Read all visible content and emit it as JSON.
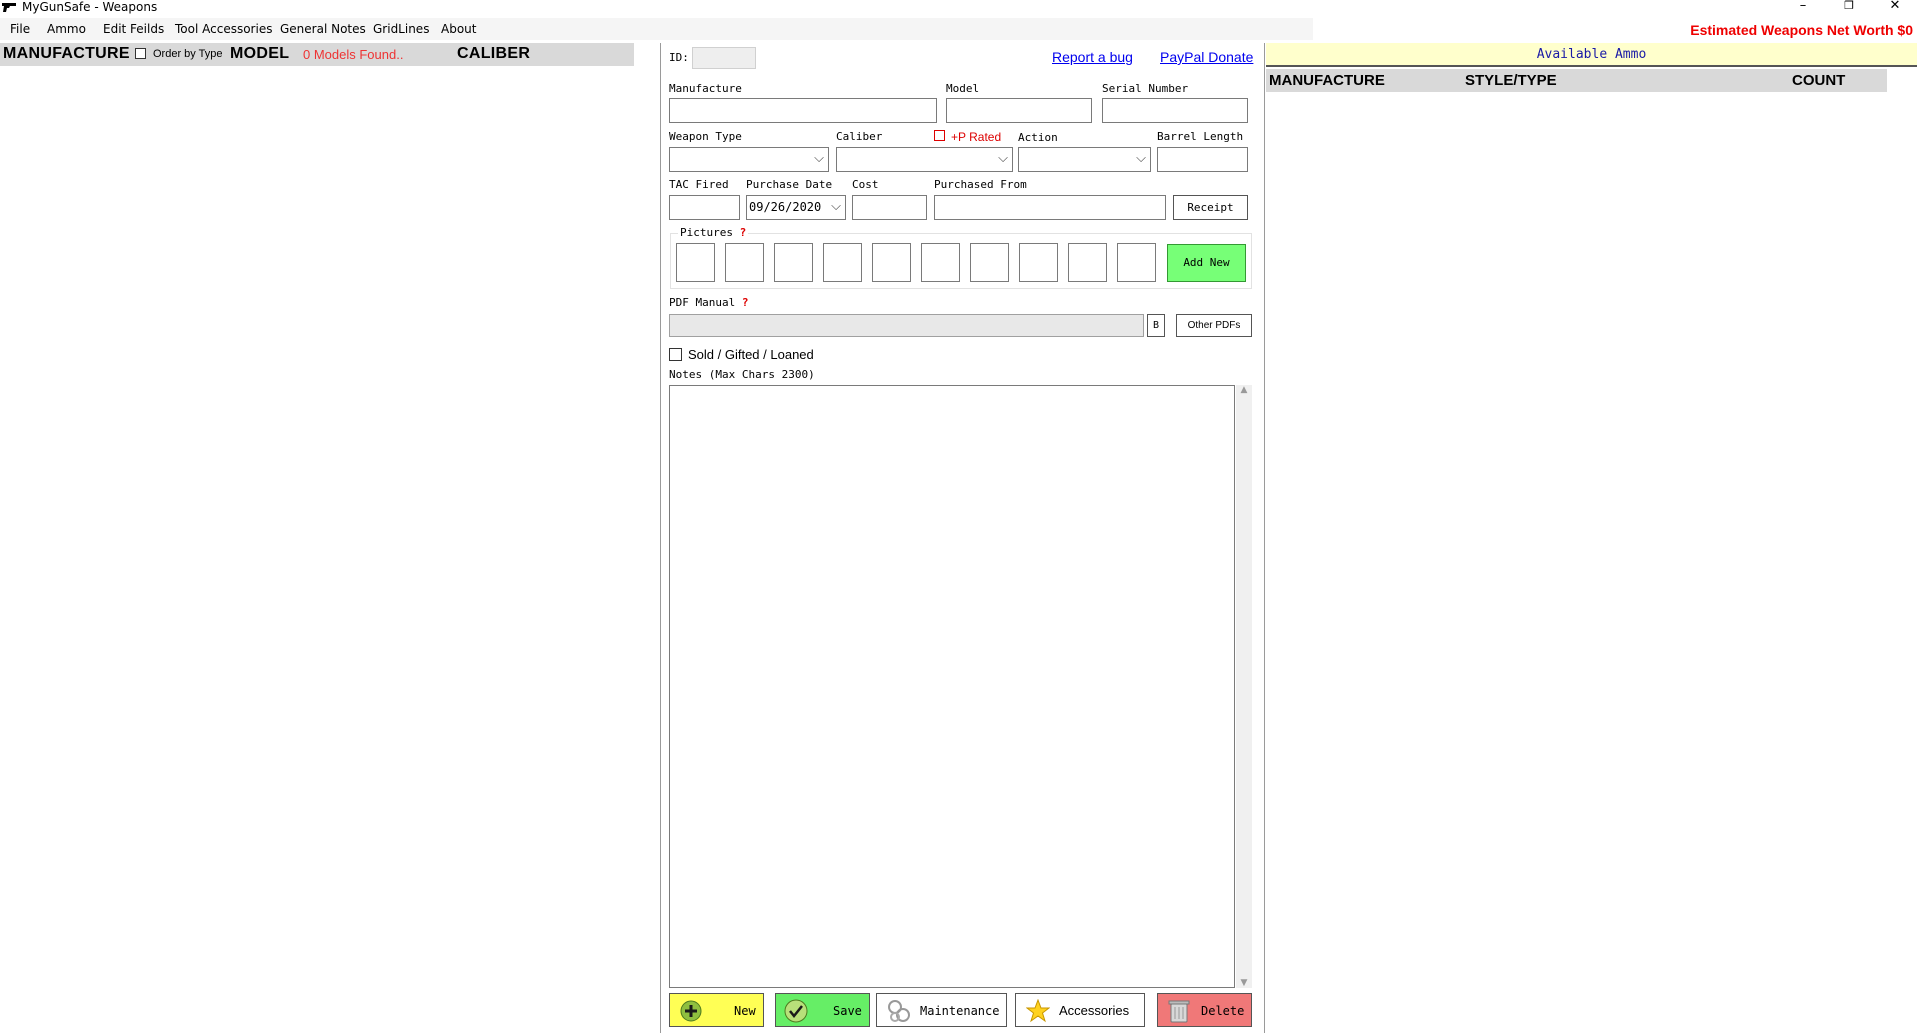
{
  "window": {
    "title": "MyGunSafe - Weapons",
    "minimize": "–",
    "restore": "❐",
    "close": "✕"
  },
  "menu": [
    "File",
    "Ammo",
    "Edit Feilds",
    "Tool Accessories",
    "General Notes",
    "GridLines",
    "About"
  ],
  "net_worth": "Estimated Weapons Net Worth $0",
  "left_list": {
    "col_manufacture": "MANUFACTURE",
    "order_by_type": "Order by Type",
    "col_model": "MODEL",
    "models_found": "0 Models Found..",
    "col_caliber": "CALIBER"
  },
  "form": {
    "id_label": "ID:",
    "report_bug": "Report a bug",
    "paypal": "PayPal Donate",
    "manufacture_label": "Manufacture",
    "model_label": "Model",
    "serial_label": "Serial Number",
    "weapon_type_label": "Weapon Type",
    "caliber_label": "Caliber",
    "plus_p_label": "+P Rated",
    "action_label": "Action",
    "barrel_label": "Barrel Length",
    "tac_label": "TAC Fired",
    "purchase_date_label": "Purchase Date",
    "purchase_date_value": "09/26/2020",
    "cost_label": "Cost",
    "purchased_from_label": "Purchased From",
    "receipt_button": "Receipt",
    "pictures_label": "Pictures",
    "help_mark": "?",
    "add_new_button": "Add New",
    "pdf_label": "PDF Manual",
    "browse_button": "B",
    "other_pdfs_button": "Other PDFs",
    "sold_label": "Sold / Gifted / Loaned",
    "notes_label": "Notes (Max Chars 2300)"
  },
  "buttons": {
    "new": "New",
    "save": "Save",
    "maintenance": "Maintenance",
    "accessories": "Accessories",
    "delete": "Delete"
  },
  "ammo": {
    "title": "Available Ammo",
    "col_manufacture": "MANUFACTURE",
    "col_style": "STYLE/TYPE",
    "col_count": "COUNT"
  },
  "colors": {
    "new_btn": "#ffff55",
    "save_btn": "#66ee66",
    "add_new_btn": "#77ff77",
    "delete_btn": "#f07878",
    "ammo_bar": "#ffffcc",
    "header_gray": "#d9d9d9",
    "net_worth": "#ee0000"
  },
  "icons": [
    "pistol-icon",
    "plus-icon",
    "check-icon",
    "gears-icon",
    "star-icon",
    "trash-icon"
  ]
}
